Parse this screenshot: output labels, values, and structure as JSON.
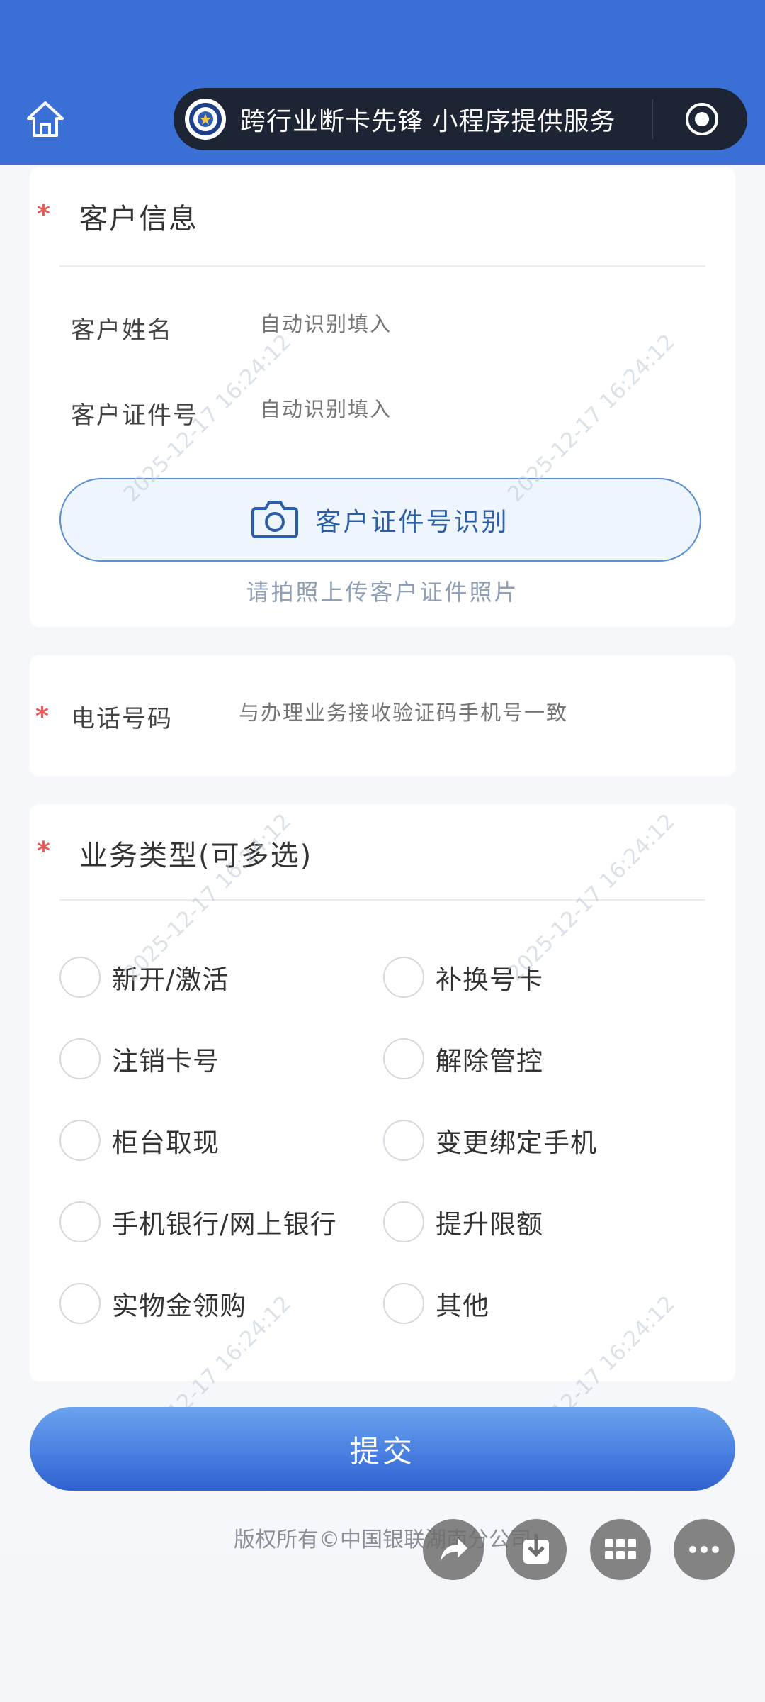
{
  "header": {
    "mini_program_name": "跨行业断卡先锋 小程序提供服务"
  },
  "customer_info": {
    "title": "客户信息",
    "required_mark": "*",
    "name_label": "客户姓名",
    "name_placeholder": "自动识别填入",
    "id_label": "客户证件号",
    "id_placeholder": "自动识别填入",
    "id_button_label": "客户证件号识别",
    "upload_hint": "请拍照上传客户证件照片"
  },
  "phone": {
    "required_mark": "*",
    "label": "电话号码",
    "placeholder": "与办理业务接收验证码手机号一致"
  },
  "business": {
    "required_mark": "*",
    "title": "业务类型(可多选)",
    "options": [
      "新开/激活",
      "补换号卡",
      "注销卡号",
      "解除管控",
      "柜台取现",
      "变更绑定手机",
      "手机银行/网上银行",
      "提升限额",
      "实物金领购",
      "其他"
    ]
  },
  "submit_label": "提交",
  "footer_text": "版权所有©中国银联湖南分公司",
  "watermark": "2025-12-17 16:24:12",
  "colors": {
    "header": "#3a6fd6",
    "accent": "#2d5fa8",
    "required": "#e25c5c"
  }
}
